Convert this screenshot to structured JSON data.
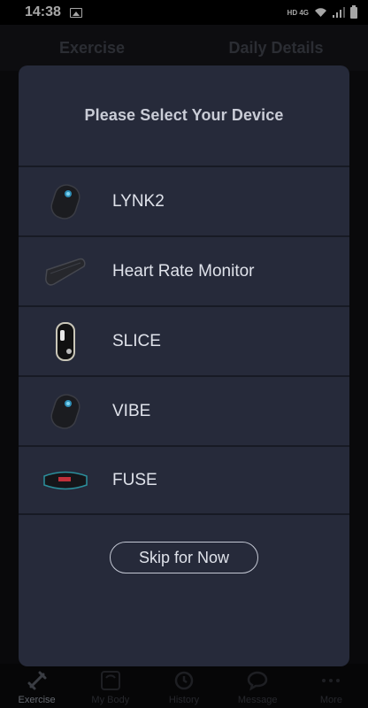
{
  "status_bar": {
    "time": "14:38",
    "indicators": "HD  4G",
    "icons": [
      "image-icon",
      "wifi-icon",
      "signal-icon",
      "battery-icon"
    ]
  },
  "background_tabs": [
    "Exercise",
    "Daily Details"
  ],
  "bottom_nav": [
    {
      "label": "Exercise",
      "icon": "dumbbell-icon",
      "active": true
    },
    {
      "label": "My Body",
      "icon": "scale-icon",
      "active": false
    },
    {
      "label": "History",
      "icon": "history-icon",
      "active": false
    },
    {
      "label": "Message",
      "icon": "message-icon",
      "active": false
    },
    {
      "label": "More",
      "icon": "more-icon",
      "active": false
    }
  ],
  "modal": {
    "title": "Please Select Your Device",
    "devices": [
      {
        "name": "LYNK2",
        "icon": "lynk2-device-icon"
      },
      {
        "name": "Heart Rate Monitor",
        "icon": "heart-rate-strap-icon"
      },
      {
        "name": "SLICE",
        "icon": "slice-device-icon"
      },
      {
        "name": "VIBE",
        "icon": "vibe-device-icon"
      },
      {
        "name": "FUSE",
        "icon": "fuse-band-icon"
      }
    ],
    "skip_label": "Skip for Now"
  },
  "colors": {
    "modal_bg": "#262a3a",
    "divider": "#171a24",
    "text": "#dfe2ea",
    "title": "#c9ccd6"
  }
}
